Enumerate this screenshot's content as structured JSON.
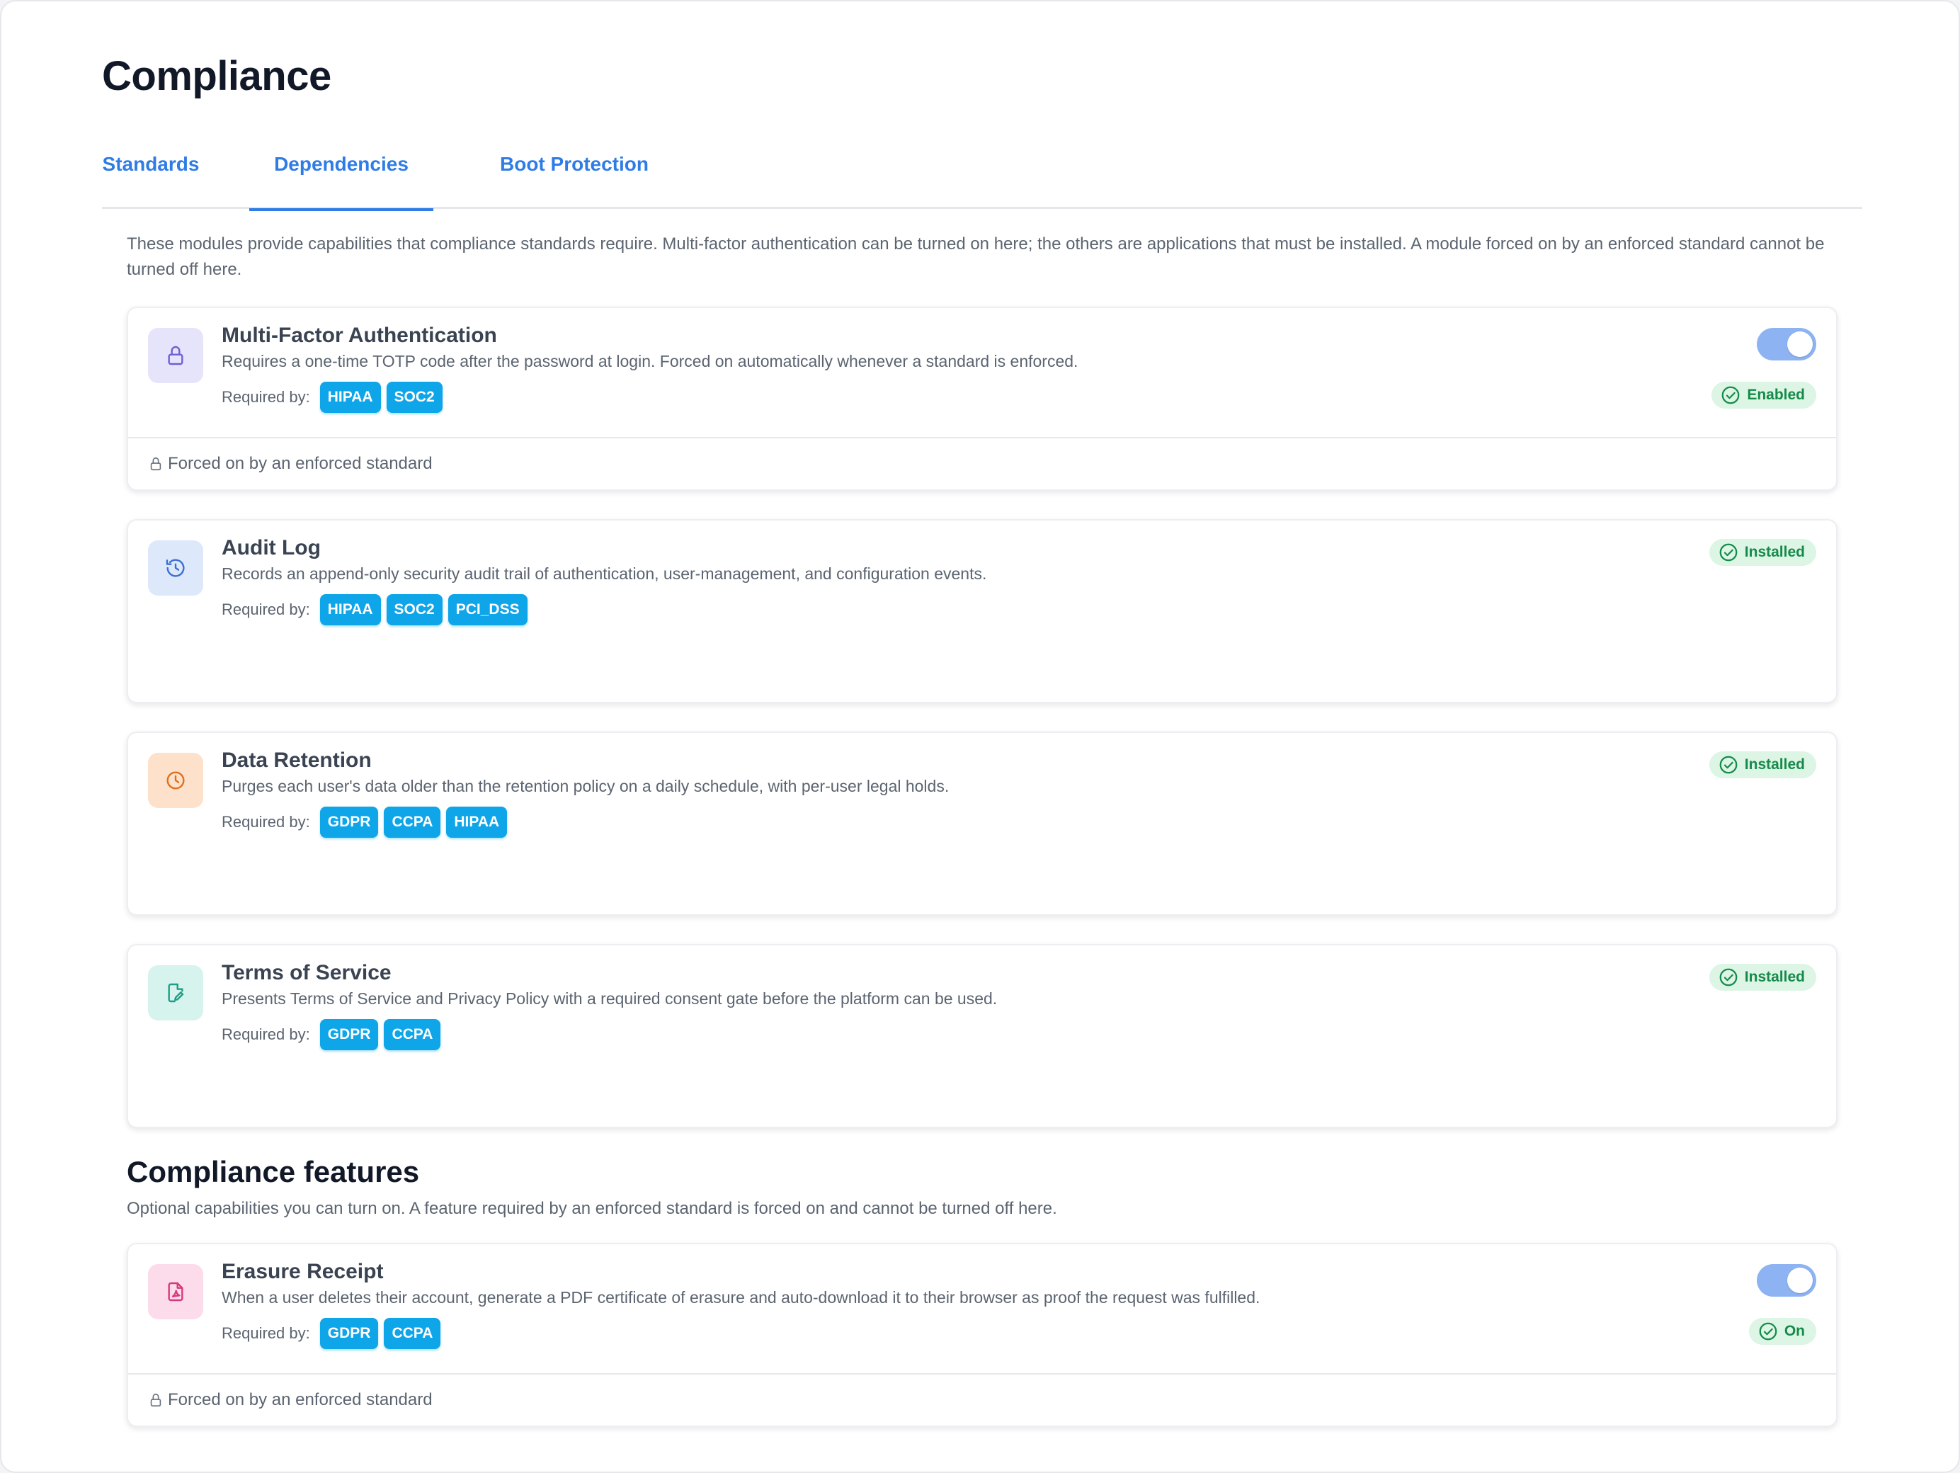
{
  "page": {
    "title": "Compliance"
  },
  "tabs": [
    {
      "label": "Standards",
      "active": false
    },
    {
      "label": "Dependencies",
      "active": true
    },
    {
      "label": "Boot Protection",
      "active": false
    }
  ],
  "intro": "These modules provide capabilities that compliance standards require. Multi-factor authentication can be turned on here; the others are applications that must be installed. A module forced on by an enforced standard cannot be turned off here.",
  "required_by_label": "Required by:",
  "modules": [
    {
      "title": "Multi-Factor Authentication",
      "description": "Requires a one-time TOTP code after the password at login. Forced on automatically whenever a standard is enforced.",
      "required_by": [
        "HIPAA",
        "SOC2"
      ],
      "icon": "lock-icon",
      "icon_bg": "#e6e4fb",
      "icon_color": "#6d5fd6",
      "toggle_on": true,
      "status": "Enabled",
      "footer": "Forced on by an enforced standard"
    },
    {
      "title": "Audit Log",
      "description": "Records an append-only security audit trail of authentication, user-management, and configuration events.",
      "required_by": [
        "HIPAA",
        "SOC2",
        "PCI_DSS"
      ],
      "icon": "history-icon",
      "icon_bg": "#dde8fb",
      "icon_color": "#3b6fd4",
      "status": "Installed"
    },
    {
      "title": "Data Retention",
      "description": "Purges each user's data older than the retention policy on a daily schedule, with per-user legal holds.",
      "required_by": [
        "GDPR",
        "CCPA",
        "HIPAA"
      ],
      "icon": "clock-icon",
      "icon_bg": "#fde1cb",
      "icon_color": "#e0701f",
      "status": "Installed"
    },
    {
      "title": "Terms of Service",
      "description": "Presents Terms of Service and Privacy Policy with a required consent gate before the platform can be used.",
      "required_by": [
        "GDPR",
        "CCPA"
      ],
      "icon": "document-edit-icon",
      "icon_bg": "#d7f3ee",
      "icon_color": "#1e9e86",
      "status": "Installed"
    }
  ],
  "features_section": {
    "title": "Compliance features",
    "description": "Optional capabilities you can turn on. A feature required by an enforced standard is forced on and cannot be turned off here."
  },
  "features": [
    {
      "title": "Erasure Receipt",
      "description": "When a user deletes their account, generate a PDF certificate of erasure and auto-download it to their browser as proof the request was fulfilled.",
      "required_by": [
        "GDPR",
        "CCPA"
      ],
      "icon": "pdf-file-icon",
      "icon_bg": "#fcdcea",
      "icon_color": "#d63a7c",
      "toggle_on": true,
      "status": "On",
      "footer": "Forced on by an enforced standard"
    }
  ],
  "colors": {
    "accent": "#2f7ce6",
    "chip": "#0ea5e9",
    "status_bg": "#dcf5e5",
    "status_text": "#168a4a",
    "toggle_on": "#8db3f3"
  }
}
